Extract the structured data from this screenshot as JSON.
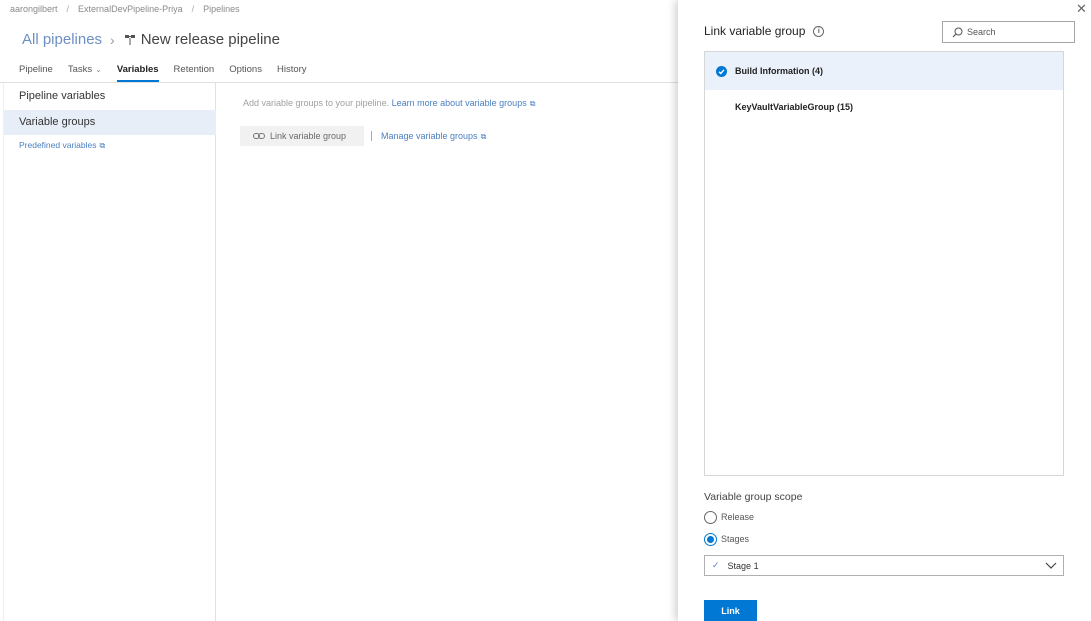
{
  "breadcrumb": [
    "aarongilbert",
    "ExternalDevPipeline-Priya",
    "Pipelines"
  ],
  "header": {
    "all_pipelines": "All pipelines",
    "pipeline_name": "New release pipeline"
  },
  "tabs": [
    {
      "label": "Pipeline"
    },
    {
      "label": "Tasks"
    },
    {
      "label": "Variables"
    },
    {
      "label": "Retention"
    },
    {
      "label": "Options"
    },
    {
      "label": "History"
    }
  ],
  "leftnav": {
    "pipeline_variables": "Pipeline variables",
    "variable_groups": "Variable groups",
    "predefined_variables": "Predefined variables"
  },
  "content": {
    "hint": "Add variable groups to your pipeline.",
    "learn_more": "Learn more about variable groups",
    "link_button": "Link variable group",
    "manage_link": "Manage variable groups"
  },
  "panel": {
    "title": "Link variable group",
    "search_placeholder": "Search",
    "groups": [
      {
        "label": "Build Information (4)",
        "selected": true
      },
      {
        "label": "KeyVaultVariableGroup (15)",
        "selected": false
      }
    ],
    "scope_label": "Variable group scope",
    "scope_options": [
      {
        "label": "Release",
        "checked": false
      },
      {
        "label": "Stages",
        "checked": true
      }
    ],
    "stage_value": "Stage 1",
    "link_button": "Link"
  },
  "colors": {
    "accent": "#0078d4",
    "link": "#4a7fc1",
    "selected_row": "#eaf1fa"
  }
}
